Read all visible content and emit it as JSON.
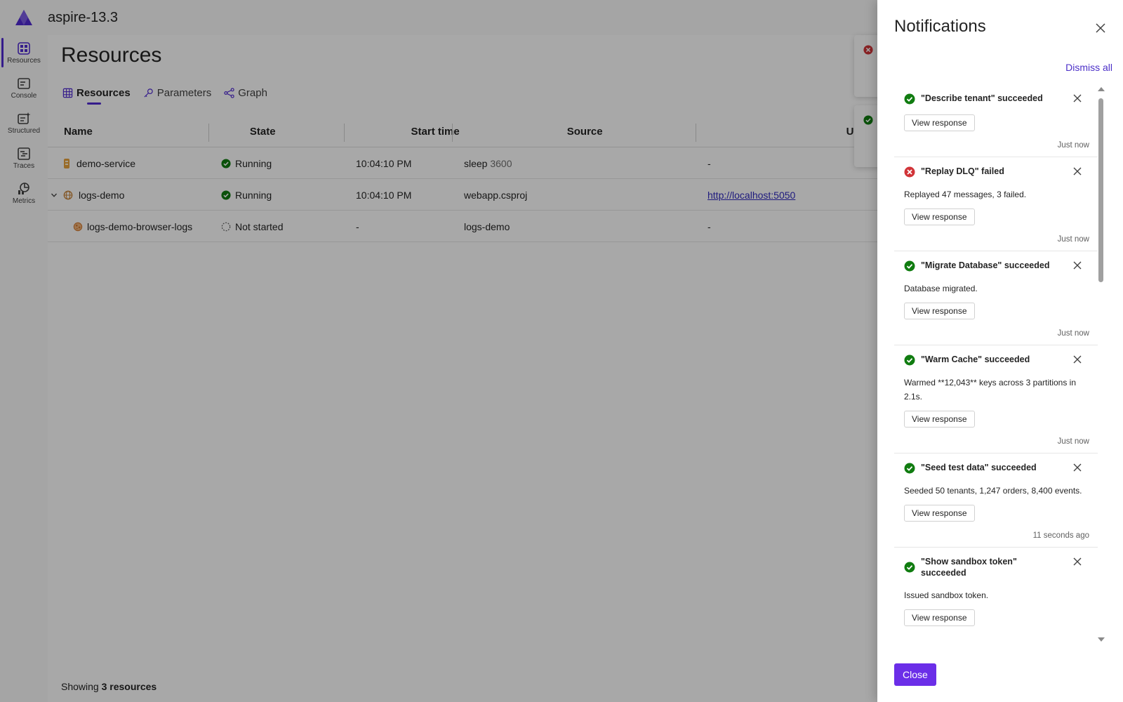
{
  "app": {
    "title": "aspire-13.3"
  },
  "colors": {
    "accent": "#512bd4",
    "success": "#107c10",
    "error": "#d13438",
    "primary_button": "#6b2ee8",
    "link": "#2f2abf"
  },
  "sidebar": {
    "items": [
      {
        "label": "Resources",
        "icon": "resources-icon",
        "active": true
      },
      {
        "label": "Console",
        "icon": "console-icon",
        "active": false
      },
      {
        "label": "Structured",
        "icon": "structured-logs-icon",
        "active": false
      },
      {
        "label": "Traces",
        "icon": "traces-icon",
        "active": false
      },
      {
        "label": "Metrics",
        "icon": "metrics-icon",
        "active": false
      }
    ]
  },
  "main": {
    "title": "Resources",
    "tabs": [
      {
        "label": "Resources",
        "icon": "table-icon",
        "selected": true
      },
      {
        "label": "Parameters",
        "icon": "key-icon",
        "selected": false
      },
      {
        "label": "Graph",
        "icon": "graph-icon",
        "selected": false
      }
    ],
    "table": {
      "columns": [
        "Name",
        "State",
        "Start time",
        "Source",
        "URLs"
      ],
      "rows": [
        {
          "name": "demo-service",
          "state": "Running",
          "start": "10:04:10 PM",
          "source": "sleep",
          "source_arg": "3600",
          "url": "-"
        },
        {
          "name": "logs-demo",
          "state": "Running",
          "start": "10:04:10 PM",
          "source": "webapp.csproj",
          "source_arg": "",
          "url": "http://localhost:5050"
        },
        {
          "name": "logs-demo-browser-logs",
          "state": "Not started",
          "start": "-",
          "source": "logs-demo",
          "source_arg": "",
          "url": "-"
        }
      ]
    },
    "footer": {
      "prefix": "Showing",
      "count": "3 resources"
    }
  },
  "notifications": {
    "title": "Notifications",
    "dismiss_all": "Dismiss all",
    "close_label": "Close",
    "items": [
      {
        "status": "success",
        "title": "\"Describe tenant\" succeeded",
        "body": "",
        "button": "View response",
        "time": "Just now"
      },
      {
        "status": "error",
        "title": "\"Replay DLQ\" failed",
        "body": "Replayed 47 messages, 3 failed.",
        "button": "View response",
        "time": "Just now"
      },
      {
        "status": "success",
        "title": "\"Migrate Database\" succeeded",
        "body": "Database migrated.",
        "button": "View response",
        "time": "Just now"
      },
      {
        "status": "success",
        "title": "\"Warm Cache\" succeeded",
        "body": "Warmed **12,043** keys across 3 partitions in 2.1s.",
        "button": "View response",
        "time": "Just now"
      },
      {
        "status": "success",
        "title": "\"Seed test data\" succeeded",
        "body": "Seeded 50 tenants, 1,247 orders, 8,400 events.",
        "button": "View response",
        "time": "11 seconds ago"
      },
      {
        "status": "success",
        "title": "\"Show sandbox token\" succeeded",
        "body": "Issued sandbox token.",
        "button": "View response",
        "time": ""
      }
    ]
  }
}
